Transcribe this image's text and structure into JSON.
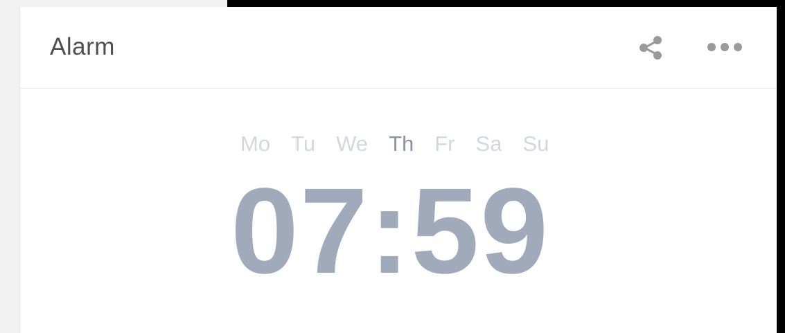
{
  "card": {
    "title": "Alarm",
    "actions": [
      {
        "name": "share",
        "icon": "share-icon"
      },
      {
        "name": "more",
        "icon": "more-horizontal-icon"
      }
    ]
  },
  "alarm": {
    "days": [
      {
        "label": "Mo",
        "active": false
      },
      {
        "label": "Tu",
        "active": false
      },
      {
        "label": "We",
        "active": false
      },
      {
        "label": "Th",
        "active": true
      },
      {
        "label": "Fr",
        "active": false
      },
      {
        "label": "Sa",
        "active": false
      },
      {
        "label": "Su",
        "active": false
      }
    ],
    "time": "07:59"
  },
  "colors": {
    "time": "#a0aabb",
    "day_inactive": "#d3d8e0",
    "day_active": "#8a93a6",
    "title": "#4f4f4f",
    "icon": "#9a9a9a"
  }
}
